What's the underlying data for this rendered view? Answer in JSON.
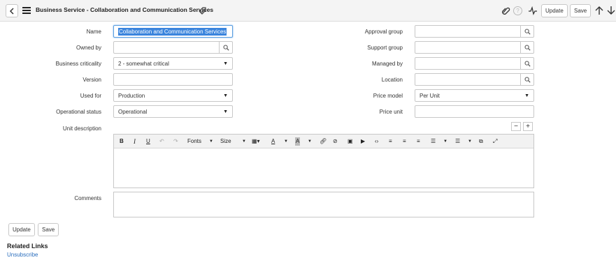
{
  "header": {
    "title": "Business Service - Collaboration and Communication Services",
    "update_label": "Update",
    "save_label": "Save"
  },
  "form": {
    "name": {
      "label": "Name",
      "value": "Collaboration and Communication Services"
    },
    "owned_by": {
      "label": "Owned by",
      "value": ""
    },
    "business_criticality": {
      "label": "Business criticality",
      "value": "2 - somewhat critical"
    },
    "version": {
      "label": "Version",
      "value": ""
    },
    "used_for": {
      "label": "Used for",
      "value": "Production"
    },
    "operational_status": {
      "label": "Operational status",
      "value": "Operational"
    },
    "approval_group": {
      "label": "Approval group",
      "value": ""
    },
    "support_group": {
      "label": "Support group",
      "value": ""
    },
    "managed_by": {
      "label": "Managed by",
      "value": ""
    },
    "location": {
      "label": "Location",
      "value": ""
    },
    "price_model": {
      "label": "Price model",
      "value": "Per Unit"
    },
    "price_unit": {
      "label": "Price unit",
      "value": ""
    },
    "unit_description": {
      "label": "Unit description"
    },
    "comments": {
      "label": "Comments"
    }
  },
  "editor_toolbar": {
    "bold": "B",
    "italic": "I",
    "underline": "U",
    "fonts": "Fonts",
    "size": "Size"
  },
  "footer": {
    "update_label": "Update",
    "save_label": "Save",
    "related_links_title": "Related Links",
    "unsubscribe_label": "Unsubscribe"
  },
  "icons": {
    "back": "chevron-left-icon",
    "menu": "hamburger-icon",
    "attachment": "paperclip-icon",
    "help": "help-circle-icon",
    "activity": "activity-pulse-icon",
    "prev": "arrow-up-icon",
    "next": "arrow-down-icon",
    "lookup": "search-icon"
  },
  "colors": {
    "header_bg": "#f4f4f4",
    "link": "#2a6ebd",
    "selection": "#3a84dd"
  }
}
